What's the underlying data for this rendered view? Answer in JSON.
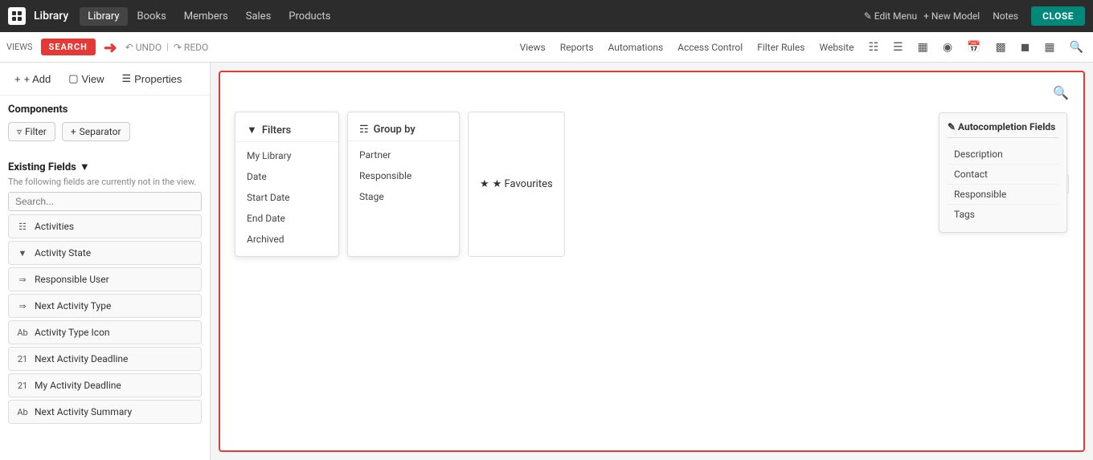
{
  "topnav": {
    "app_name": "Library",
    "nav_links": [
      "Library",
      "Books",
      "Members",
      "Sales",
      "Products"
    ],
    "edit_menu": "✎ Edit Menu",
    "new_model": "+ New Model",
    "notes": "Notes",
    "close": "CLOSE"
  },
  "toolbar": {
    "views_label": "VIEWS",
    "search_btn": "SEARCH",
    "undo": "UNDO",
    "redo": "REDO",
    "right_links": [
      "Views",
      "Reports",
      "Automations",
      "Access Control",
      "Filter Rules",
      "Website"
    ]
  },
  "sidebar": {
    "add_btn": "+ Add",
    "view_btn": "View",
    "properties_btn": "Properties",
    "components_title": "Components",
    "filter_chip": "Filter",
    "separator_chip": "Separator",
    "existing_fields_title": "Existing Fields",
    "existing_fields_desc": "The following fields are currently not in the view.",
    "search_placeholder": "Search...",
    "fields": [
      {
        "icon": "⊞",
        "label": "Activities"
      },
      {
        "icon": "▼",
        "label": "Activity State"
      },
      {
        "icon": "⇒",
        "label": "Responsible User"
      },
      {
        "icon": "⇒",
        "label": "Next Activity Type"
      },
      {
        "icon": "Ab",
        "label": "Activity Type Icon"
      },
      {
        "icon": "21",
        "label": "Next Activity Deadline"
      },
      {
        "icon": "21",
        "label": "My Activity Deadline"
      },
      {
        "icon": "Ab",
        "label": "Next Activity Summary"
      }
    ]
  },
  "content": {
    "filters": {
      "title": "Filters",
      "items": [
        "My Library",
        "Date",
        "Start Date",
        "End Date",
        "Archived"
      ]
    },
    "groupby": {
      "title": "Group by",
      "items": [
        "Partner",
        "Responsible",
        "Stage"
      ]
    },
    "favourites": "★ Favourites",
    "autocompletion": {
      "title": "✎ Autocompletion Fields",
      "items": [
        "Description",
        "Contact",
        "Responsible",
        "Tags"
      ]
    }
  }
}
